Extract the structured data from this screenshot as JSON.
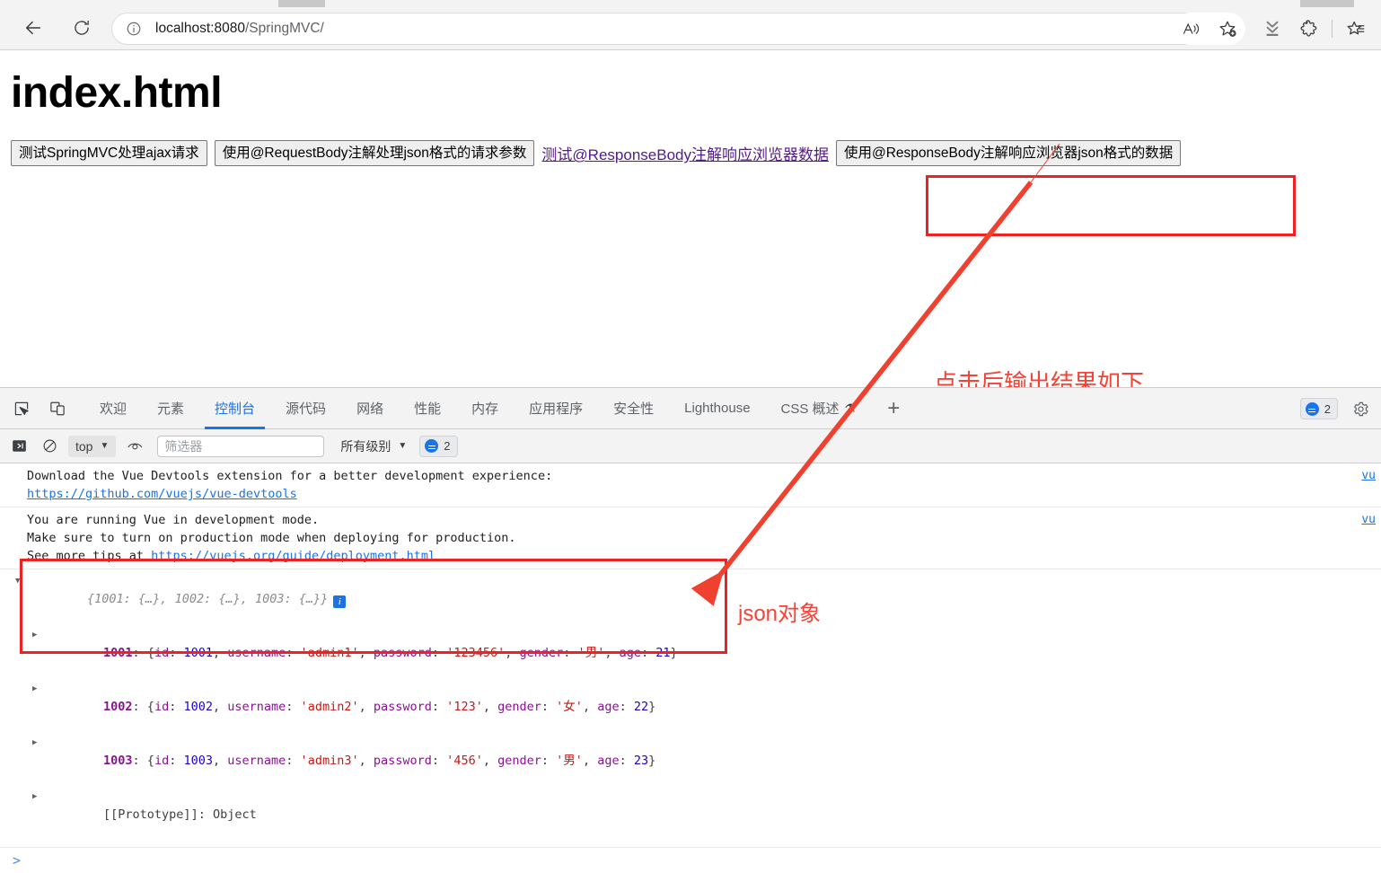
{
  "browser": {
    "back_icon": "back-arrow-icon",
    "reload_icon": "reload-icon",
    "info_icon": "site-info-icon",
    "url_host": "localhost:8080",
    "url_path": "/SpringMVC/",
    "toolbar_icons": [
      {
        "name": "read-aloud-icon",
        "label": "A"
      },
      {
        "name": "add-favorite-icon",
        "label": "star-plus"
      },
      {
        "name": "downloads-icon",
        "label": "downloads"
      },
      {
        "name": "extensions-icon",
        "label": "puzzle"
      },
      {
        "name": "collections-icon",
        "label": "collections"
      }
    ]
  },
  "page": {
    "title": "index.html",
    "buttons": [
      {
        "label": "测试SpringMVC处理ajax请求",
        "type": "button"
      },
      {
        "label": "使用@RequestBody注解处理json格式的请求参数",
        "type": "button"
      },
      {
        "label": "测试@ResponseBody注解响应浏览器数据",
        "type": "link"
      },
      {
        "label": "使用@ResponseBody注解响应浏览器json格式的数据",
        "type": "button"
      }
    ]
  },
  "annotations": {
    "click_result": "点击后输出结果如下",
    "json_object": "json对象",
    "box_color": "#ee2222",
    "text_color": "#f44336"
  },
  "devtools": {
    "panel_icons": [
      {
        "name": "inspect-element-icon"
      },
      {
        "name": "device-toolbar-icon"
      }
    ],
    "tabs": [
      {
        "label": "欢迎",
        "active": false
      },
      {
        "label": "元素",
        "active": false
      },
      {
        "label": "控制台",
        "active": true
      },
      {
        "label": "源代码",
        "active": false
      },
      {
        "label": "网络",
        "active": false
      },
      {
        "label": "性能",
        "active": false
      },
      {
        "label": "内存",
        "active": false
      },
      {
        "label": "应用程序",
        "active": false
      },
      {
        "label": "安全性",
        "active": false
      },
      {
        "label": "Lighthouse",
        "active": false
      },
      {
        "label": "CSS 概述",
        "active": false,
        "experimental": true
      }
    ],
    "add_tab_label": "+",
    "message_count": "2",
    "settings_icon": "gear-icon",
    "console_toolbar": {
      "sidebar_icon": "console-sidebar-icon",
      "clear_icon": "clear-console-icon",
      "context": "top",
      "eye_icon": "live-expression-icon",
      "filter_placeholder": "筛选器",
      "filter_value": "",
      "levels": "所有级别",
      "badge_count": "2"
    },
    "console_entries": [
      {
        "lines": [
          "Download the Vue Devtools extension for a better development experience:",
          "https://github.com/vuejs/vue-devtools"
        ],
        "link": "https://github.com/vuejs/vue-devtools",
        "source": "vu"
      },
      {
        "lines": [
          "You are running Vue in development mode.",
          "Make sure to turn on production mode when deploying for production.",
          "See more tips at https://vuejs.org/guide/deployment.html"
        ],
        "link": "https://vuejs.org/guide/deployment.html",
        "source": "vu"
      }
    ],
    "console_object": {
      "preview": "{1001: {…}, 1002: {…}, 1003: {…}}",
      "rows": [
        {
          "key": "1001",
          "id": "1001",
          "username": "admin1",
          "password": "123456",
          "gender": "男",
          "age": "21"
        },
        {
          "key": "1002",
          "id": "1002",
          "username": "admin2",
          "password": "123",
          "gender": "女",
          "age": "22"
        },
        {
          "key": "1003",
          "id": "1003",
          "username": "admin3",
          "password": "456",
          "gender": "男",
          "age": "23"
        }
      ],
      "prototype_label": "[[Prototype]]",
      "prototype_value": "Object",
      "field_names": {
        "id": "id",
        "username": "username",
        "password": "password",
        "gender": "gender",
        "age": "age"
      }
    },
    "prompt_symbol": ">"
  }
}
